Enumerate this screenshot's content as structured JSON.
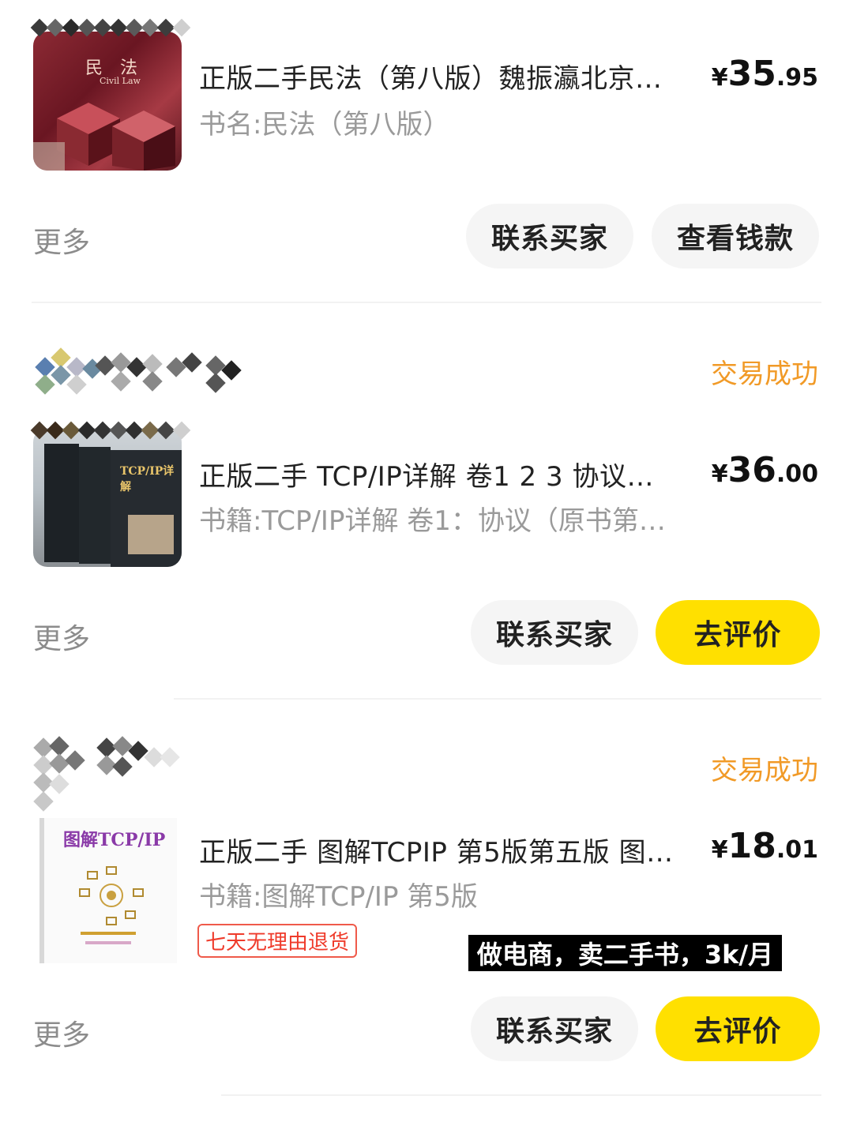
{
  "orders": [
    {
      "title": "正版二手民法（第八版）魏振瀛北京…",
      "subtitle": "书名:民法（第八版）",
      "price": {
        "currency": "¥",
        "integer": "35",
        "decimal": ".95"
      },
      "more": "更多",
      "buttons": [
        "联系买家",
        "查看钱款"
      ],
      "cover_text": {
        "title": "民　法",
        "sub": "Civil Law"
      }
    },
    {
      "status": "交易成功",
      "title": "正版二手 TCP/IP详解 卷1 2 3 协议…",
      "subtitle": "书籍:TCP/IP详解 卷1：协议（原书第…",
      "price": {
        "currency": "¥",
        "integer": "36",
        "decimal": ".00"
      },
      "more": "更多",
      "buttons": [
        "联系买家",
        "去评价"
      ],
      "cover_text": {
        "title": "TCP/IP详解"
      }
    },
    {
      "status": "交易成功",
      "title": "正版二手 图解TCPIP 第5版第五版 图…",
      "subtitle": "书籍:图解TCP/IP 第5版",
      "price": {
        "currency": "¥",
        "integer": "18",
        "decimal": ".01"
      },
      "tag": "七天无理由退货",
      "more": "更多",
      "buttons": [
        "联系买家",
        "去评价"
      ],
      "cover_text": {
        "title": "图解TCP/IP"
      }
    }
  ],
  "overlay_caption": "做电商，卖二手书，3k/月",
  "colors": {
    "accent_yellow": "#ffe000",
    "status_orange": "#f19a27",
    "tag_red": "#ef3b2b"
  }
}
